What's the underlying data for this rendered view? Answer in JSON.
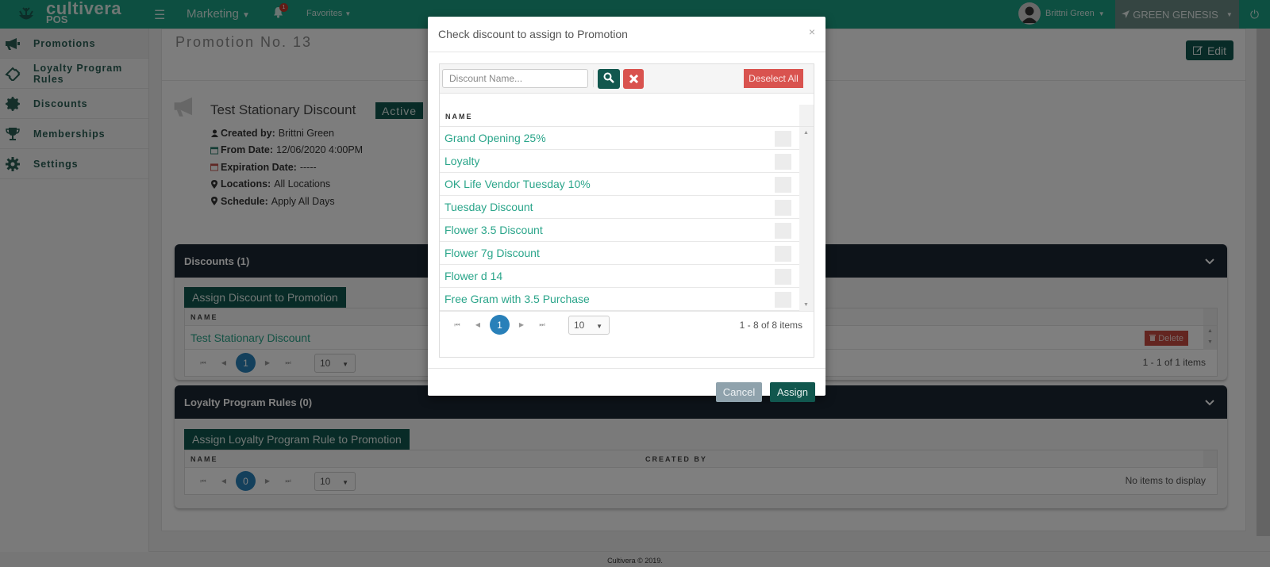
{
  "topbar": {
    "logo_text": "cultivera",
    "logo_sub": "POS",
    "menu": "Marketing",
    "notification_count": "1",
    "favorites": "Favorites",
    "user_name": "Brittni Green",
    "store_name": "GREEN GENESIS",
    "brand_color": "#1b9e82"
  },
  "sidebar": {
    "items": [
      {
        "label": "Promotions",
        "icon": "megaphone-icon"
      },
      {
        "label": "Loyalty Program Rules",
        "icon": "ticket-icon"
      },
      {
        "label": "Discounts",
        "icon": "badge-icon"
      },
      {
        "label": "Memberships",
        "icon": "trophy-icon"
      },
      {
        "label": "Settings",
        "icon": "gear-icon"
      }
    ]
  },
  "promotion": {
    "title": "Promotion No. 13",
    "edit_label": "Edit",
    "name": "Test Stationary Discount",
    "status": "Active",
    "created_by_label": "Created by:",
    "created_by": "Brittni Green",
    "from_date_label": "From Date:",
    "from_date": "12/06/2020 4:00PM",
    "expiration_label": "Expiration Date:",
    "expiration": "-----",
    "locations_label": "Locations:",
    "locations": "All Locations",
    "schedule_label": "Schedule:",
    "schedule": "Apply All Days"
  },
  "discounts_section": {
    "title": "Discounts (1)",
    "assign_label": "Assign Discount to Promotion",
    "column_name": "NAME",
    "rows": [
      {
        "name": "Test Stationary Discount",
        "action": "Delete"
      }
    ],
    "page": "1",
    "page_size": "10",
    "pager_info": "1 - 1 of 1 items"
  },
  "loyalty_section": {
    "title": "Loyalty Program Rules (0)",
    "assign_label": "Assign Loyalty Program Rule to Promotion",
    "column_name": "NAME",
    "column_created_by": "CREATED BY",
    "page": "0",
    "page_size": "10",
    "pager_info": "No items to display"
  },
  "modal": {
    "title": "Check discount to assign to Promotion",
    "close": "×",
    "search_placeholder": "Discount Name...",
    "deselect_all": "Deselect All",
    "column_name": "NAME",
    "rows": [
      {
        "name": "Grand Opening 25%",
        "checked": false
      },
      {
        "name": "Loyalty",
        "checked": false
      },
      {
        "name": "OK Life Vendor Tuesday 10%",
        "checked": false
      },
      {
        "name": "Tuesday Discount",
        "checked": false
      },
      {
        "name": "Flower 3.5 Discount",
        "checked": false
      },
      {
        "name": "Flower 7g Discount",
        "checked": false
      },
      {
        "name": "Flower d 14",
        "checked": false
      },
      {
        "name": "Free Gram with 3.5 Purchase",
        "checked": false
      }
    ],
    "page": "1",
    "page_size": "10",
    "pager_info": "1 - 8 of 8 items",
    "cancel_label": "Cancel",
    "assign_label": "Assign"
  },
  "footer": {
    "text": "Cultivera © 2019."
  }
}
